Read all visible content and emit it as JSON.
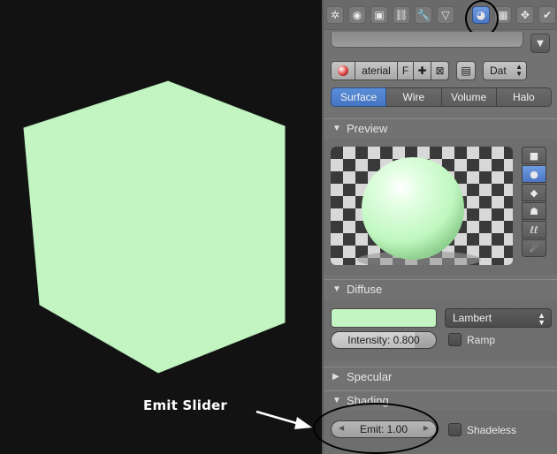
{
  "annotation": {
    "label": "Emit Slider"
  },
  "colors": {
    "viewport_bg": "#121212",
    "cube_front": "#c3f5c3",
    "panel_bg": "#727272",
    "accent": "#4a76c4",
    "circle_outline": "#000000"
  },
  "tabs": [
    {
      "icon": "scene-icon",
      "glyph": "✲",
      "active": false
    },
    {
      "icon": "world-icon",
      "glyph": "◉",
      "active": false
    },
    {
      "icon": "object-icon",
      "glyph": "▣",
      "active": false
    },
    {
      "icon": "constraint-icon",
      "glyph": "⛓",
      "active": false
    },
    {
      "icon": "modifier-wrench-icon",
      "glyph": "🔧",
      "active": false
    },
    {
      "icon": "mesh-data-icon",
      "glyph": "▽",
      "active": false
    },
    {
      "icon": "material-icon",
      "glyph": "◕",
      "active": true
    },
    {
      "icon": "texture-icon",
      "glyph": "▦",
      "active": false
    },
    {
      "icon": "particles-icon",
      "glyph": "✥",
      "active": false
    },
    {
      "icon": "physics-icon",
      "glyph": "✔",
      "active": false
    }
  ],
  "material": {
    "name": "aterial",
    "fake_user": "F",
    "datablock": "Dat"
  },
  "modes": [
    {
      "label": "Surface",
      "active": true
    },
    {
      "label": "Wire",
      "active": false
    },
    {
      "label": "Volume",
      "active": false
    },
    {
      "label": "Halo",
      "active": false
    }
  ],
  "preview": {
    "header": "Preview",
    "shapes": [
      {
        "icon": "flat-plane-icon",
        "glyph": "■",
        "active": false
      },
      {
        "icon": "sphere-icon",
        "glyph": "●",
        "active": true
      },
      {
        "icon": "cube-icon",
        "glyph": "◆",
        "active": false
      },
      {
        "icon": "monkey-icon",
        "glyph": "☗",
        "active": false
      },
      {
        "icon": "hair-strands-icon",
        "glyph": "ℓℓ",
        "active": false
      },
      {
        "icon": "sphere-sky-icon",
        "glyph": "☄",
        "active": false
      }
    ]
  },
  "diffuse": {
    "header": "Diffuse",
    "color": "#c3f5c3",
    "shader": "Lambert",
    "intensity_label": "Intensity: 0.800",
    "intensity_value": 0.8,
    "ramp_label": "Ramp"
  },
  "specular": {
    "header": "Specular"
  },
  "shading": {
    "header": "Shading",
    "emit_label": "Emit: 1.00",
    "emit_value": 1.0,
    "shadeless_label": "Shadeless"
  }
}
